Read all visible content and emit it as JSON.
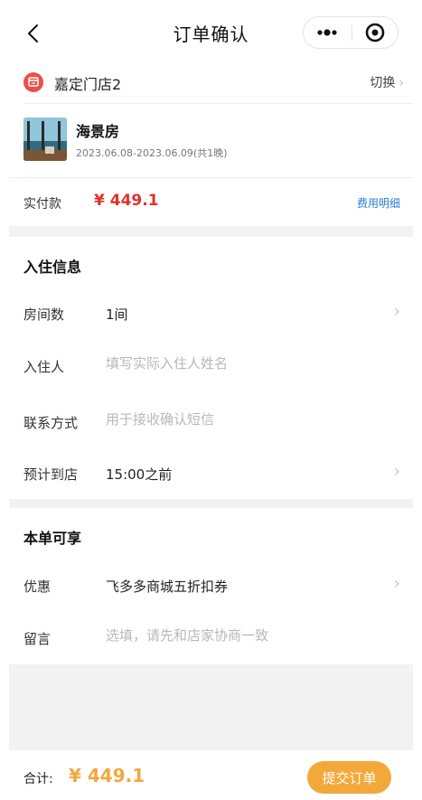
{
  "nav": {
    "title": "订单确认",
    "back_icon": "chevron-left-icon",
    "more_icon": "more-dots-icon",
    "close_icon": "target-circle-icon"
  },
  "store": {
    "icon": "store-icon",
    "icon_color": "#e8504a",
    "name": "嘉定门店2",
    "switch_label": "切换"
  },
  "room": {
    "name": "海景房",
    "dates": "2023.06.08-2023.06.09(共1晚)"
  },
  "payment": {
    "label": "实付款",
    "amount": "¥ 449.1",
    "detail_link": "费用明细"
  },
  "checkin": {
    "title": "入住信息",
    "rooms_label": "房间数",
    "rooms_value": "1间",
    "guest_label": "入住人",
    "guest_placeholder": "填写实际入住人姓名",
    "contact_label": "联系方式",
    "contact_placeholder": "用于接收确认短信",
    "arrival_label": "预计到店",
    "arrival_value": "15:00之前"
  },
  "enjoy": {
    "title": "本单可享",
    "discount_label": "优惠",
    "discount_value": "飞多多商城五折扣券",
    "message_label": "留言",
    "message_placeholder": "选填，请先和店家协商一致"
  },
  "footer": {
    "total_label": "合计:",
    "total_amount": "¥ 449.1",
    "submit_label": "提交订单"
  },
  "colors": {
    "price_red": "#e0322b",
    "accent_orange": "#f3a93a",
    "link_blue": "#2b7bd6",
    "page_bg": "#f2f2f2"
  }
}
